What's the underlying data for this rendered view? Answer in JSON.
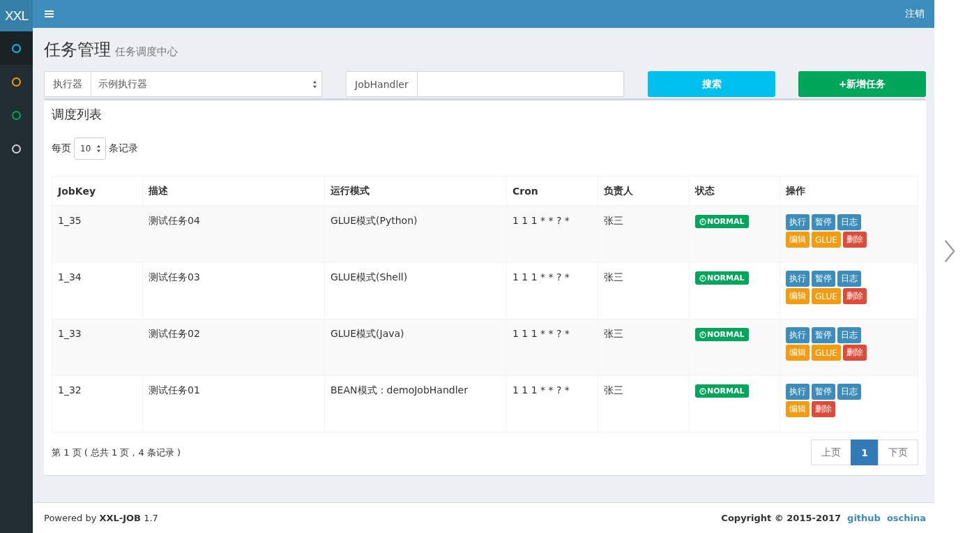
{
  "header": {
    "logo": "XXL",
    "logout": "注销"
  },
  "sidebar": {
    "items": [
      {
        "color": "#00c0ef",
        "selected": true
      },
      {
        "color": "#f39c12",
        "selected": false
      },
      {
        "color": "#00a65a",
        "selected": false
      },
      {
        "color": "#d2d6de",
        "selected": false
      }
    ]
  },
  "page": {
    "title": "任务管理",
    "subtitle": "任务调度中心"
  },
  "filters": {
    "executor_label": "执行器",
    "executor_value": "示例执行器",
    "handler_label": "JobHandler",
    "search_button": "搜索",
    "add_button": "+新增任务"
  },
  "box": {
    "title": "调度列表",
    "page_size_prefix": "每页",
    "page_size": "10",
    "page_size_suffix": "条记录"
  },
  "table": {
    "columns": [
      "JobKey",
      "描述",
      "运行模式",
      "Cron",
      "负责人",
      "状态",
      "操作"
    ],
    "rows": [
      {
        "key": "1_35",
        "desc": "测试任务04",
        "mode": "GLUE模式(Python)",
        "cron": "1 1 1 * * ? *",
        "owner": "张三",
        "status": "NORMAL",
        "actions": [
          {
            "label": "执行",
            "kind": "primary"
          },
          {
            "label": "暂停",
            "kind": "primary"
          },
          {
            "label": "日志",
            "kind": "primary"
          },
          {
            "label": "编辑",
            "kind": "warning"
          },
          {
            "label": "GLUE",
            "kind": "warning"
          },
          {
            "label": "删除",
            "kind": "danger"
          }
        ]
      },
      {
        "key": "1_34",
        "desc": "测试任务03",
        "mode": "GLUE模式(Shell)",
        "cron": "1 1 1 * * ? *",
        "owner": "张三",
        "status": "NORMAL",
        "actions": [
          {
            "label": "执行",
            "kind": "primary"
          },
          {
            "label": "暂停",
            "kind": "primary"
          },
          {
            "label": "日志",
            "kind": "primary"
          },
          {
            "label": "编辑",
            "kind": "warning"
          },
          {
            "label": "GLUE",
            "kind": "warning"
          },
          {
            "label": "删除",
            "kind": "danger"
          }
        ]
      },
      {
        "key": "1_33",
        "desc": "测试任务02",
        "mode": "GLUE模式(Java)",
        "cron": "1 1 1 * * ? *",
        "owner": "张三",
        "status": "NORMAL",
        "actions": [
          {
            "label": "执行",
            "kind": "primary"
          },
          {
            "label": "暂停",
            "kind": "primary"
          },
          {
            "label": "日志",
            "kind": "primary"
          },
          {
            "label": "编辑",
            "kind": "warning"
          },
          {
            "label": "GLUE",
            "kind": "warning"
          },
          {
            "label": "删除",
            "kind": "danger"
          }
        ]
      },
      {
        "key": "1_32",
        "desc": "测试任务01",
        "mode": "BEAN模式：demoJobHandler",
        "cron": "1 1 1 * * ? *",
        "owner": "张三",
        "status": "NORMAL",
        "actions": [
          {
            "label": "执行",
            "kind": "primary"
          },
          {
            "label": "暂停",
            "kind": "primary"
          },
          {
            "label": "日志",
            "kind": "primary"
          },
          {
            "label": "编辑",
            "kind": "warning"
          },
          {
            "label": "删除",
            "kind": "danger"
          }
        ]
      }
    ]
  },
  "info": "第 1 页 ( 总共 1 页，4 条记录 )",
  "pagination": [
    {
      "label": "上页",
      "selected": false
    },
    {
      "label": "1",
      "selected": true
    },
    {
      "label": "下页",
      "selected": false
    }
  ],
  "footer": {
    "powered": "Powered by **XXL-JOB** 1.7",
    "copyright": "Copyright © 2015-2017",
    "links": [
      "github",
      "oschina"
    ]
  }
}
